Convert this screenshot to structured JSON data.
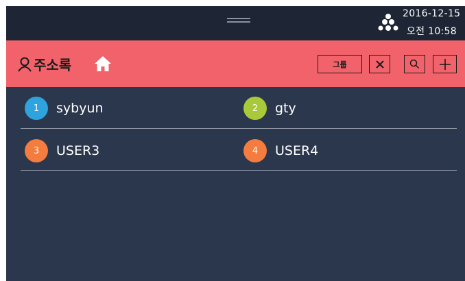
{
  "status": {
    "date": "2016-12-15",
    "time": "오전 10:58"
  },
  "header": {
    "title": "주소록",
    "group_label": "그룹",
    "close_glyph": "✕",
    "search_glyph": "⚲",
    "add_glyph": "+"
  },
  "contacts": [
    {
      "number": "1",
      "name": "sybyun",
      "color": "#2ea3de"
    },
    {
      "number": "2",
      "name": "gty",
      "color": "#a9c93a"
    },
    {
      "number": "3",
      "name": "USER3",
      "color": "#f47c3e"
    },
    {
      "number": "4",
      "name": "USER4",
      "color": "#f47c3e"
    }
  ],
  "colors": {
    "header_bg": "#f2626b",
    "screen_bg": "#2b374c",
    "statusbar_bg": "#1e2534"
  },
  "icons": {
    "status_logo": "dot-cluster-logo",
    "header_person": "person-icon",
    "header_home": "home-icon"
  }
}
